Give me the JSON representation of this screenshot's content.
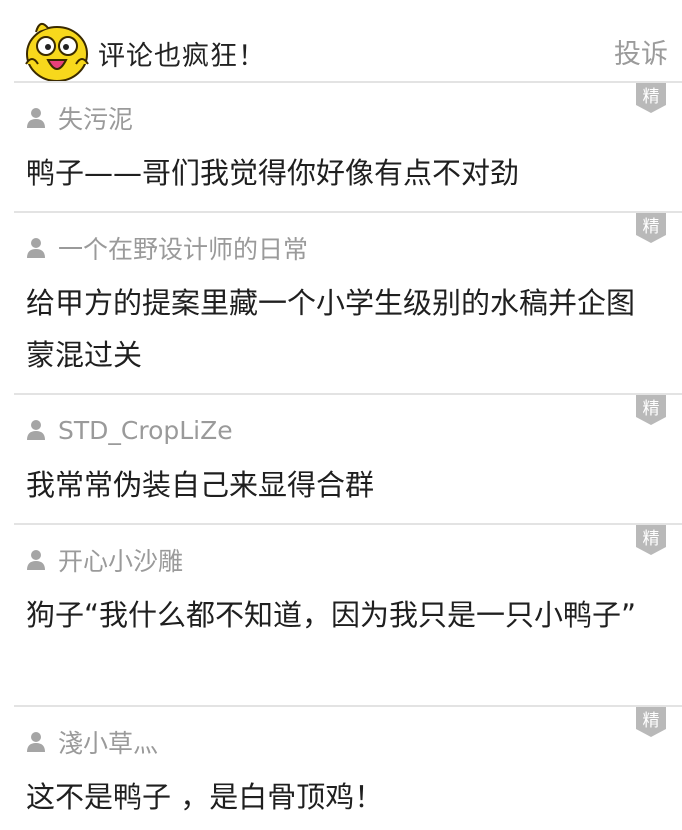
{
  "header": {
    "title": "评论也疯狂！",
    "report_label": "投诉",
    "mascot_icon": "yellow-bird-mascot-icon"
  },
  "badge_label": "精",
  "colors": {
    "badge": "#b9b9b9",
    "divider": "#e3e3e3",
    "username": "#9a9a9a",
    "text": "#1f1f1f",
    "mascot": "#f7d81c"
  },
  "comments": [
    {
      "user": "失污泥",
      "text": "鸭子——哥们我觉得你好像有点不对劲"
    },
    {
      "user": "一个在野设计师的日常",
      "text": "给甲方的提案里藏一个小学生级别的水稿并企图蒙混过关"
    },
    {
      "user": "STD_CropLiZe",
      "text": "我常常伪装自己来显得合群"
    },
    {
      "user": "开心小沙雕",
      "text": "狗子“我什么都不知道，因为我只是一只小鸭子”"
    },
    {
      "user": "淺小草灬",
      "text": "这不是鸭子 ，是白骨顶鸡！"
    }
  ]
}
